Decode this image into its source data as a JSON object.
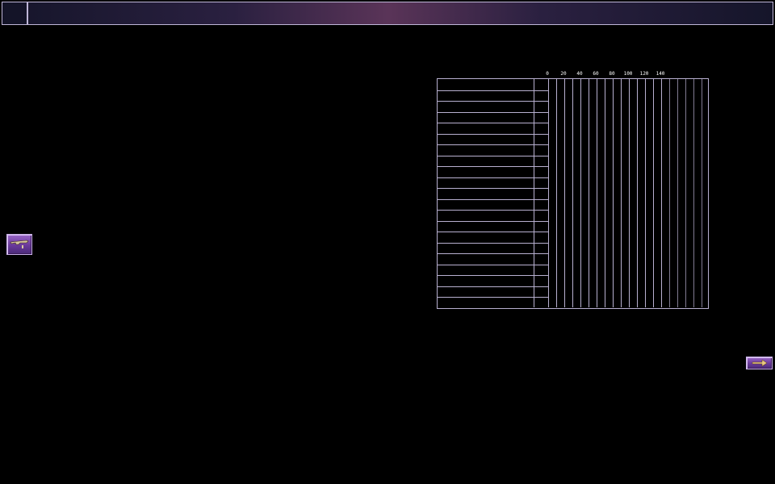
{
  "title_bar": {
    "title": ""
  },
  "weapon_button": {
    "icon": "rifle-icon"
  },
  "next_button": {
    "icon": "arrow-right-icon"
  },
  "stats_grid": {
    "scale": [
      "0",
      "20",
      "40",
      "60",
      "80",
      "100",
      "120",
      "140"
    ],
    "row_count": 21,
    "rows": [
      {
        "name": "",
        "value": ""
      },
      {
        "name": "",
        "value": ""
      },
      {
        "name": "",
        "value": ""
      },
      {
        "name": "",
        "value": ""
      },
      {
        "name": "",
        "value": ""
      },
      {
        "name": "",
        "value": ""
      },
      {
        "name": "",
        "value": ""
      },
      {
        "name": "",
        "value": ""
      },
      {
        "name": "",
        "value": ""
      },
      {
        "name": "",
        "value": ""
      },
      {
        "name": "",
        "value": ""
      },
      {
        "name": "",
        "value": ""
      },
      {
        "name": "",
        "value": ""
      },
      {
        "name": "",
        "value": ""
      },
      {
        "name": "",
        "value": ""
      },
      {
        "name": "",
        "value": ""
      },
      {
        "name": "",
        "value": ""
      },
      {
        "name": "",
        "value": ""
      },
      {
        "name": "",
        "value": ""
      },
      {
        "name": "",
        "value": ""
      },
      {
        "name": "",
        "value": ""
      }
    ]
  },
  "colors": {
    "background": "#000000",
    "frame": "#bfb6d8",
    "button_top": "#9a66c8",
    "button_bottom": "#4a2a78",
    "grid_line": "#b8b0d0"
  }
}
